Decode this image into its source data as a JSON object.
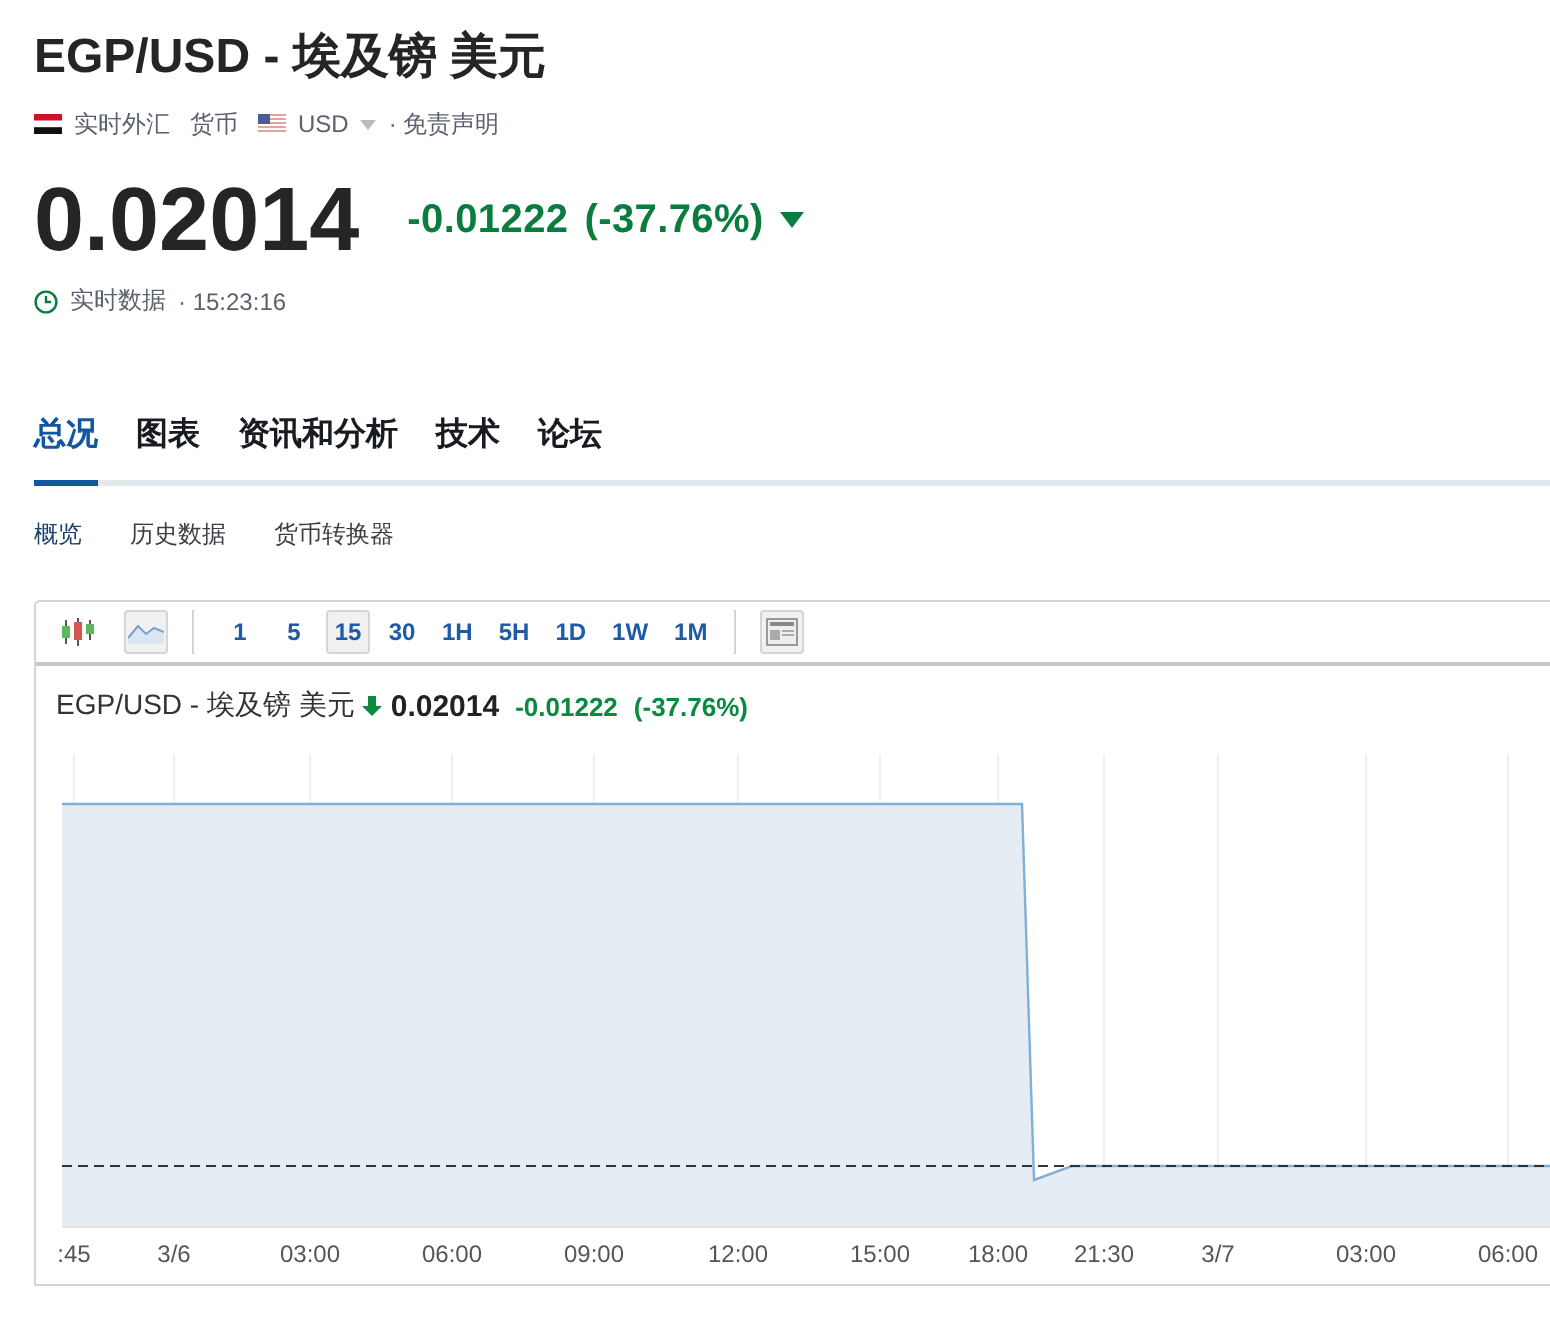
{
  "title": "EGP/USD - 埃及镑 美元",
  "meta": {
    "market": "实时外汇",
    "category": "货币",
    "currency": "USD",
    "disclaimer": "· 免责声明"
  },
  "quote": {
    "price": "0.02014",
    "change": "-0.01222",
    "change_pct": "(-37.76%)",
    "falling": true,
    "status": "实时数据",
    "time": "· 15:23:16"
  },
  "tabs": [
    {
      "label": "总况",
      "selected": true
    },
    {
      "label": "图表",
      "selected": false
    },
    {
      "label": "资讯和分析",
      "selected": false
    },
    {
      "label": "技术",
      "selected": false
    },
    {
      "label": "论坛",
      "selected": false
    }
  ],
  "subtabs": [
    {
      "label": "概览",
      "selected": true
    },
    {
      "label": "历史数据",
      "selected": false
    },
    {
      "label": "货币转换器",
      "selected": false
    }
  ],
  "chart_widget": {
    "chart_types": [
      {
        "kind": "candles",
        "selected": false
      },
      {
        "kind": "line",
        "selected": true
      }
    ],
    "intervals": [
      {
        "label": "1",
        "selected": false
      },
      {
        "label": "5",
        "selected": false
      },
      {
        "label": "15",
        "selected": true
      },
      {
        "label": "30",
        "selected": false
      },
      {
        "label": "1H",
        "selected": false
      },
      {
        "label": "5H",
        "selected": false
      },
      {
        "label": "1D",
        "selected": false
      },
      {
        "label": "1W",
        "selected": false
      },
      {
        "label": "1M",
        "selected": false
      }
    ],
    "legend": {
      "name": "EGP/USD - 埃及镑 美元",
      "falling": true,
      "price": "0.02014",
      "change": "-0.01222",
      "change_pct": "(-37.76%)"
    },
    "x_labels": [
      ":45",
      "3/6",
      "03:00",
      "06:00",
      "09:00",
      "12:00",
      "15:00",
      "18:00",
      "21:30",
      "3/7",
      "03:00",
      "06:00"
    ]
  }
}
